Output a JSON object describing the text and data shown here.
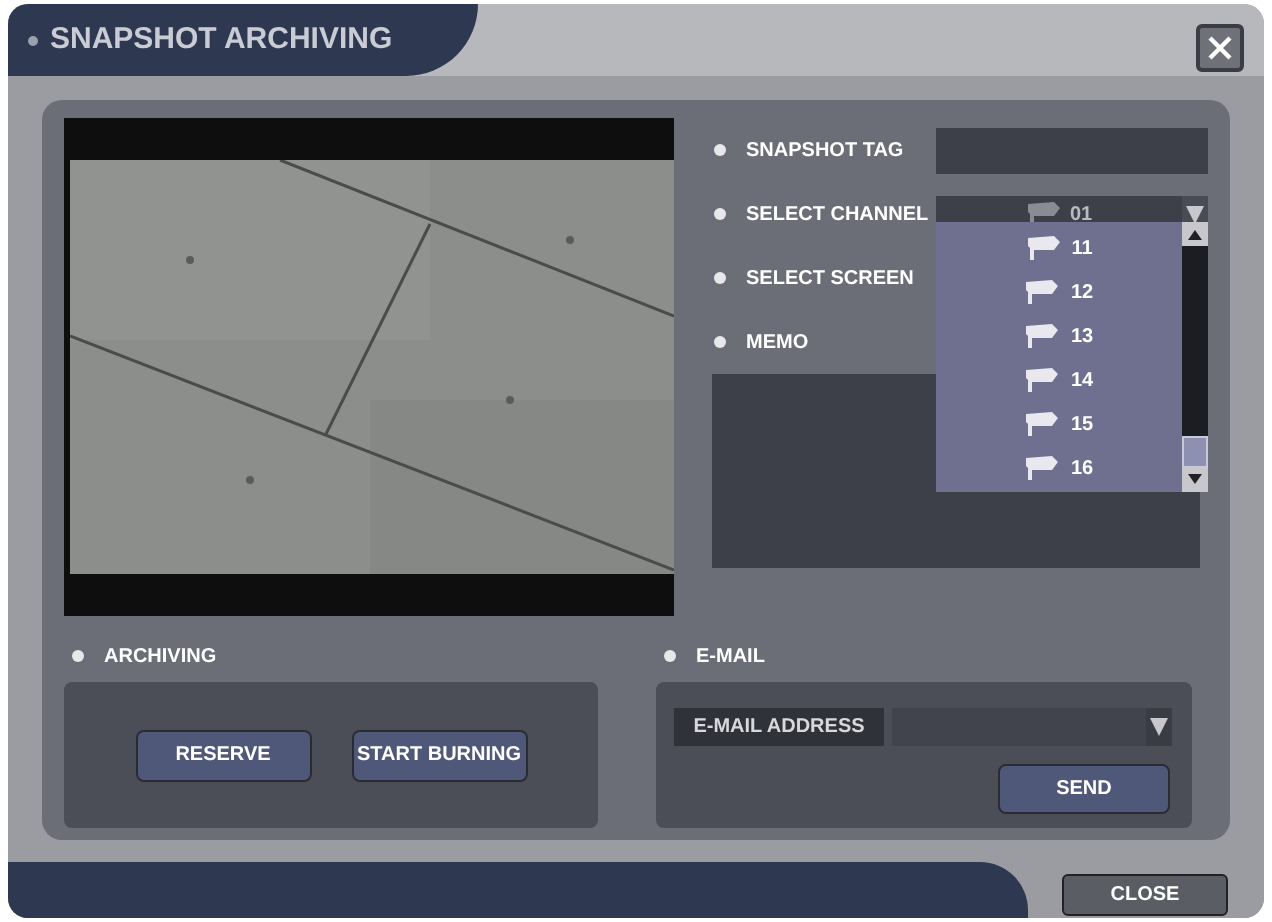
{
  "window": {
    "title": "SNAPSHOT ARCHIVING"
  },
  "fields": [
    {
      "label": "SNAPSHOT TAG",
      "kind": "text"
    },
    {
      "label": "SELECT CHANNEL",
      "kind": "select",
      "value": "01"
    },
    {
      "label": "SELECT SCREEN",
      "kind": "none"
    },
    {
      "label": "MEMO",
      "kind": "memo"
    }
  ],
  "channel_list": [
    "11",
    "12",
    "13",
    "14",
    "15",
    "16"
  ],
  "archiving": {
    "label": "ARCHIVING",
    "buttons": [
      "RESERVE",
      "START BURNING"
    ]
  },
  "email": {
    "label": "E-MAIL",
    "address_label": "E-MAIL ADDRESS",
    "button": "SEND"
  },
  "close_button": "CLOSE"
}
